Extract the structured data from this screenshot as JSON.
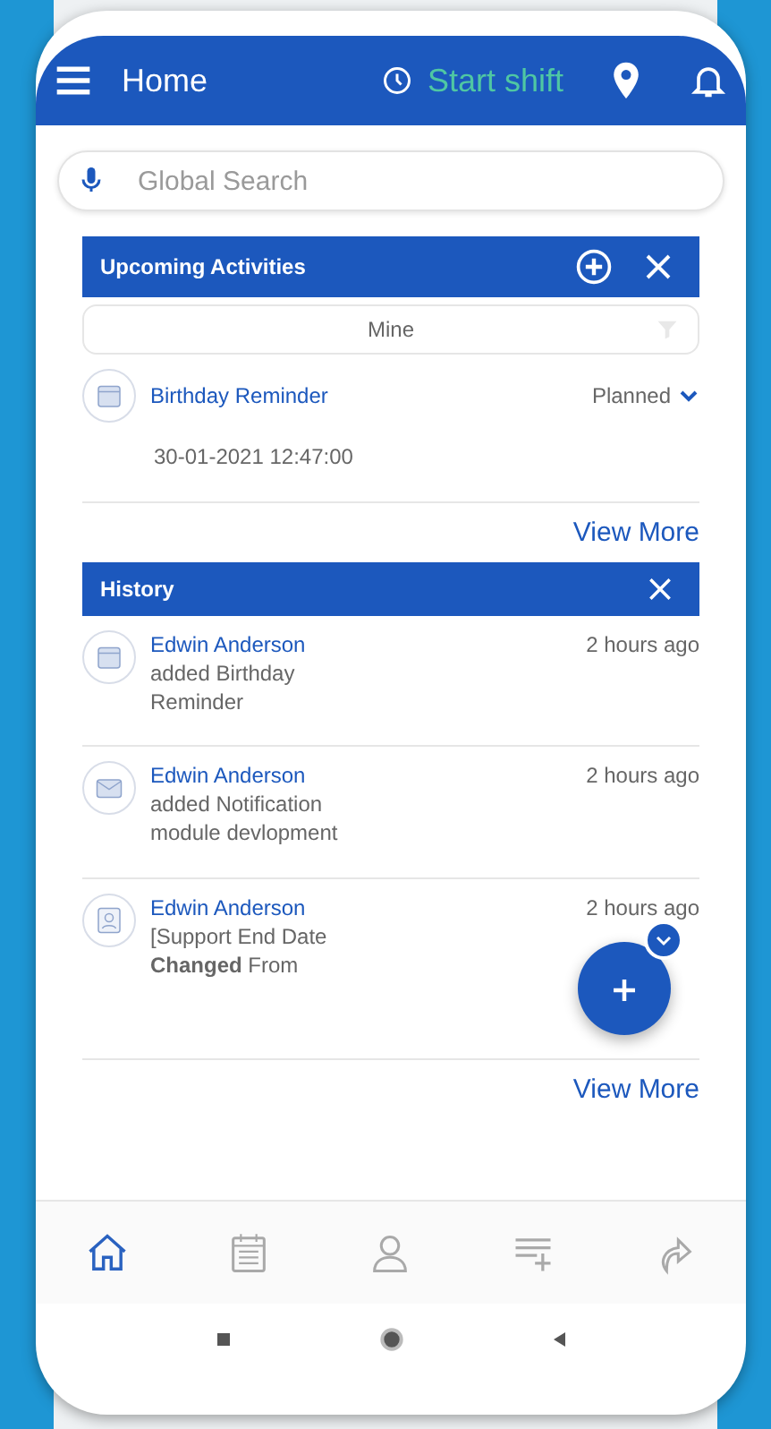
{
  "app_bar": {
    "title": "Home",
    "shift_label": "Start shift"
  },
  "search": {
    "placeholder": "Global Search"
  },
  "upcoming": {
    "title": "Upcoming Activities",
    "filter": "Mine",
    "view_more": "View More",
    "items": [
      {
        "title": "Birthday Reminder",
        "status": "Planned",
        "datetime": "30-01-2021 12:47:00"
      }
    ]
  },
  "history": {
    "title": "History",
    "view_more": "View More",
    "items": [
      {
        "kind": "calendar",
        "name": "Edwin Anderson",
        "text": "added Birthday Reminder",
        "time": "2 hours ago"
      },
      {
        "kind": "mail",
        "name": "Edwin Anderson",
        "text": "added Notification module devlopment",
        "time": "2 hours ago"
      },
      {
        "kind": "contact",
        "name": "Edwin Anderson",
        "text": "[Support End Date **Changed** From",
        "time": "2 hours ago"
      }
    ]
  },
  "bottom_nav": [
    {
      "kind": "home",
      "selected": true
    },
    {
      "kind": "calendar",
      "selected": false
    },
    {
      "kind": "person",
      "selected": false
    },
    {
      "kind": "add-list",
      "selected": false
    },
    {
      "kind": "share",
      "selected": false
    }
  ]
}
